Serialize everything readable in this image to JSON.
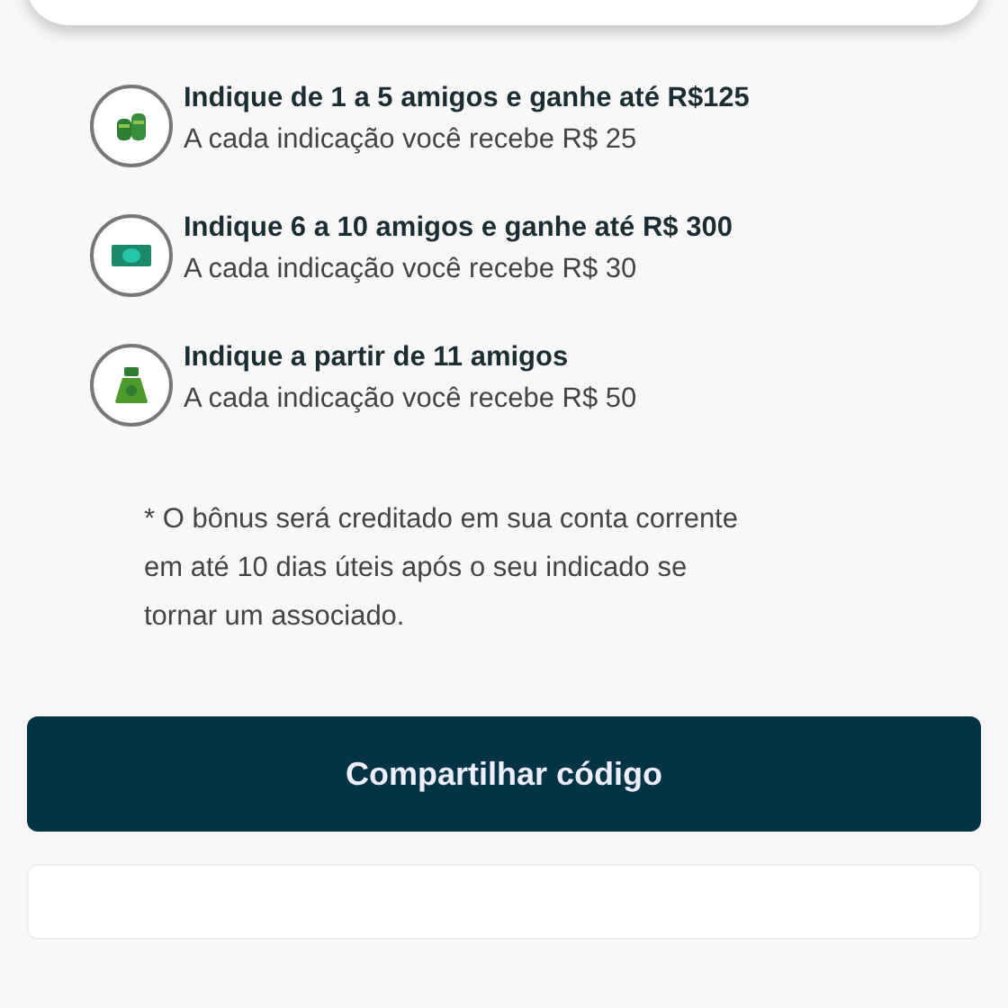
{
  "tiers": [
    {
      "kind": "coins",
      "title": "Indique de 1 a 5 amigos e ganhe até R$125",
      "subtitle": "A cada indicação você recebe R$ 25"
    },
    {
      "kind": "banknote",
      "title": "Indique 6 a 10 amigos e ganhe até R$ 300",
      "subtitle": "A cada indicação você recebe R$ 30"
    },
    {
      "kind": "bag",
      "title": "Indique a partir de 11 amigos",
      "subtitle": "A cada indicação você recebe R$ 50"
    }
  ],
  "note": "* O bônus será creditado em sua conta corrente em até 10 dias úteis após o seu indicado se tornar um associado.",
  "share_button": "Compartilhar código"
}
